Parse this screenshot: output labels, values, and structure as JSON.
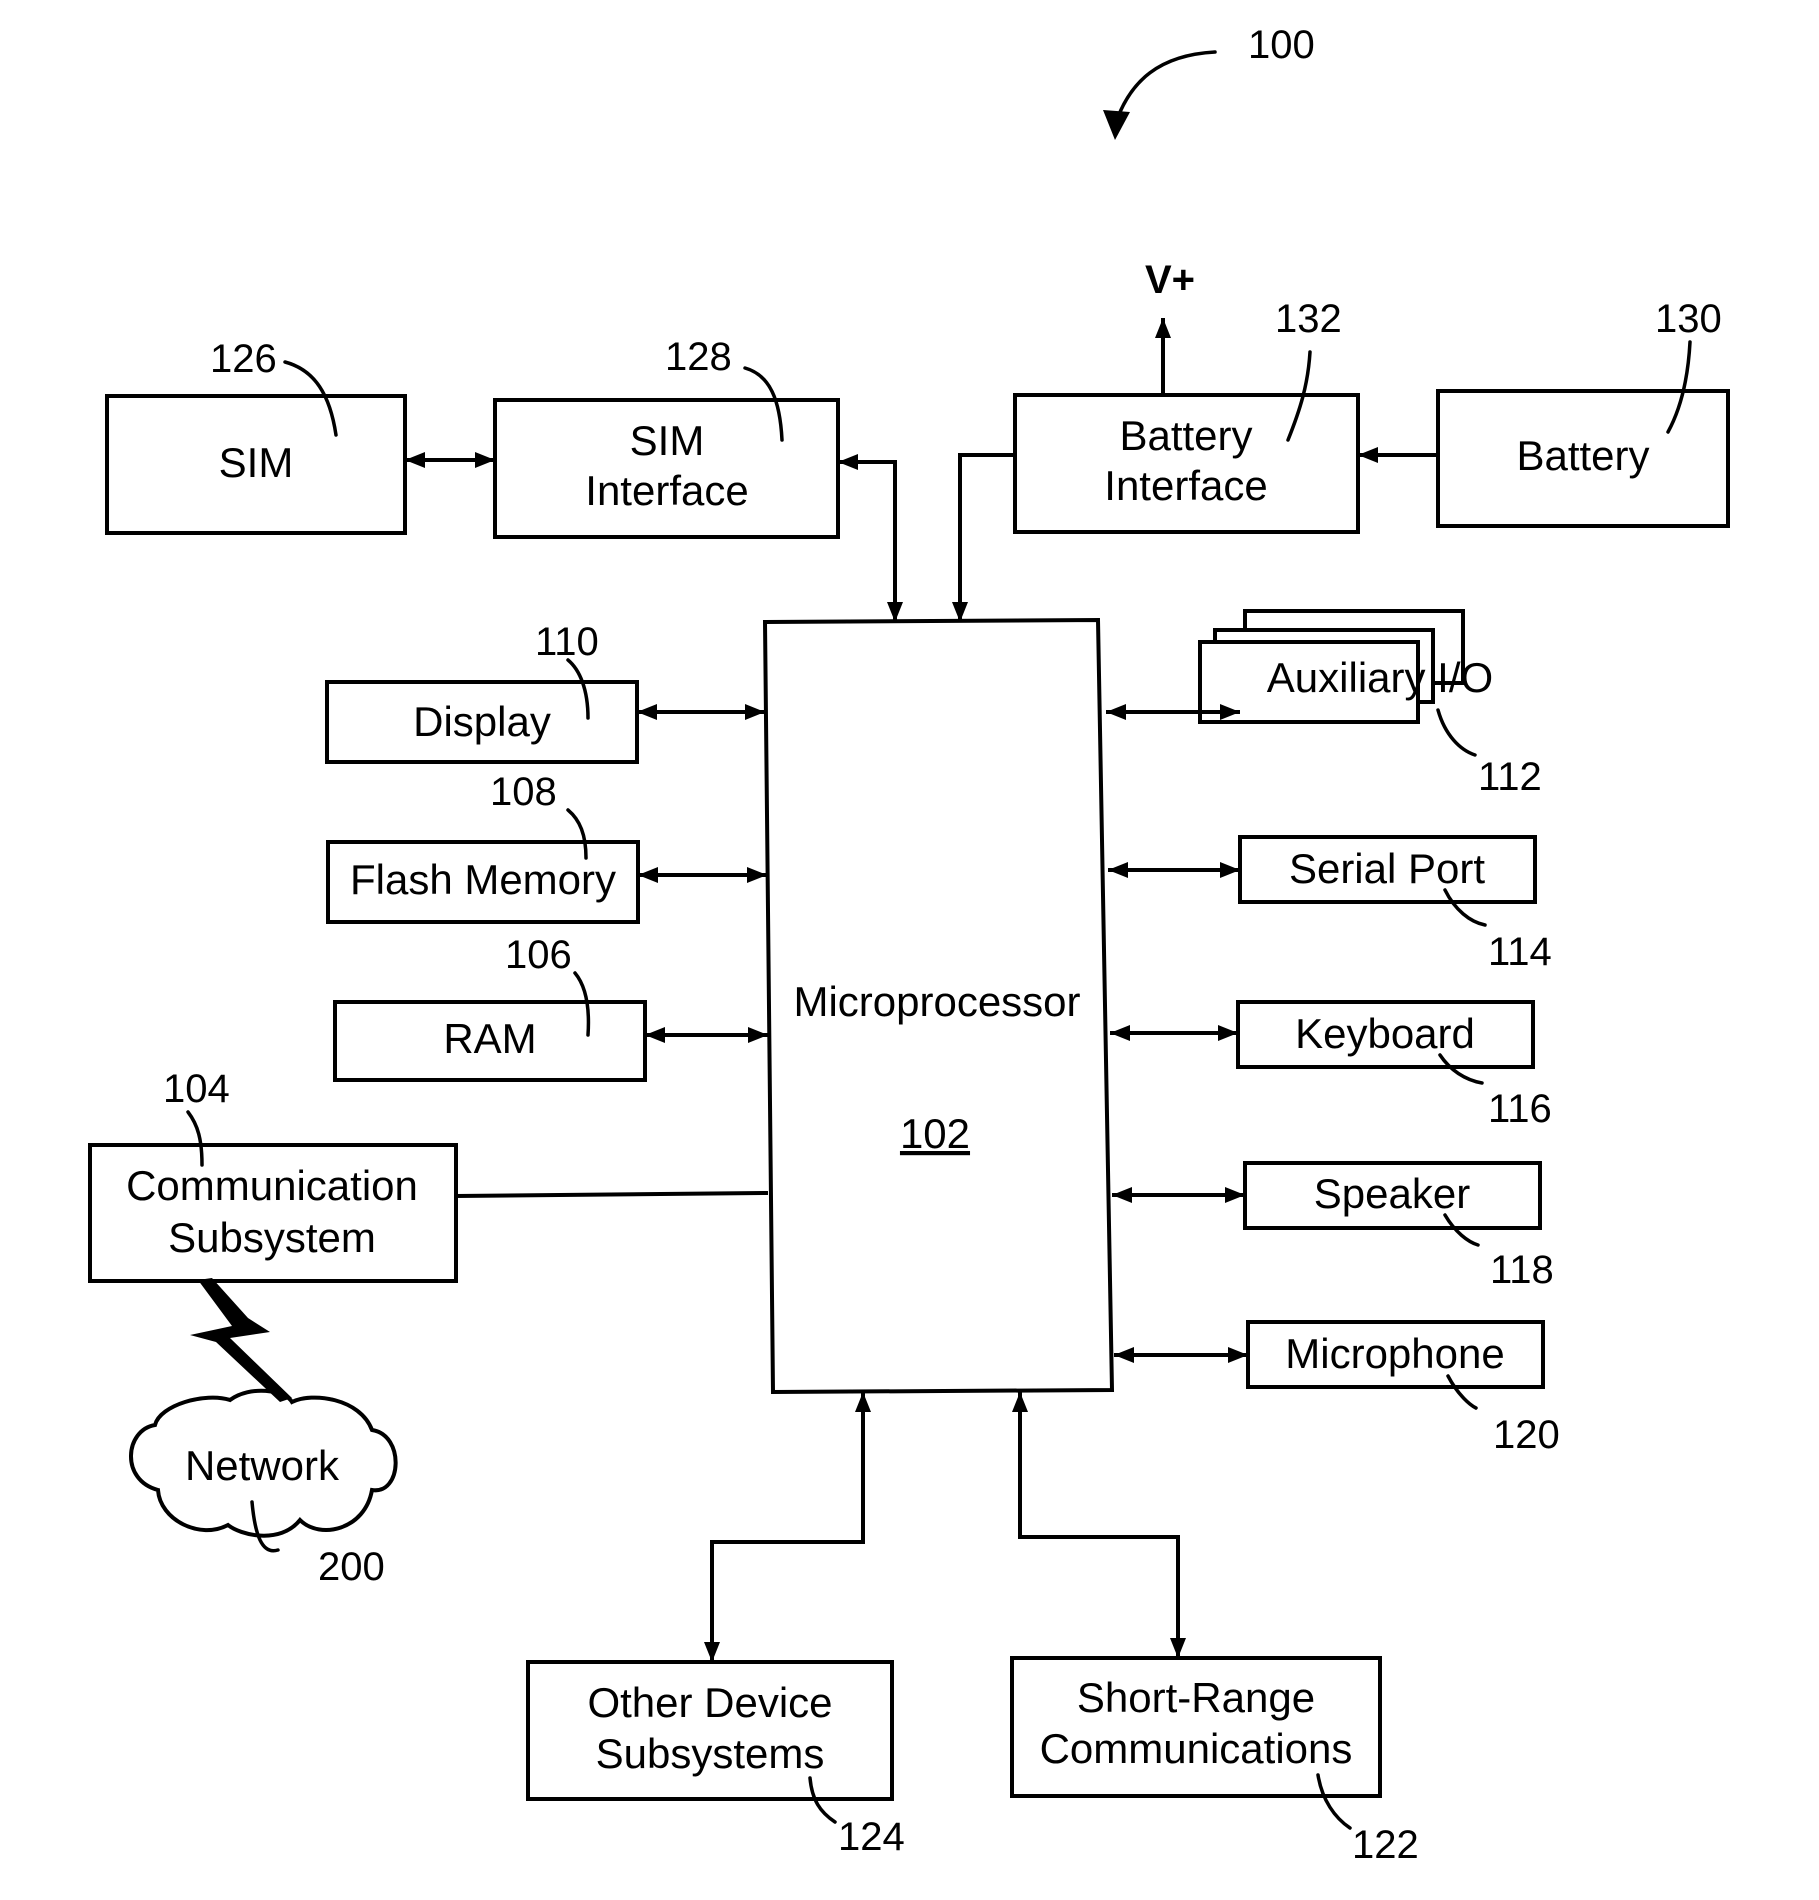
{
  "figure": {
    "figure_ref": "100",
    "vplus": "V+"
  },
  "blocks": {
    "sim": {
      "label_lines": [
        "SIM"
      ],
      "ref": "126"
    },
    "sim_interface": {
      "label_lines": [
        "SIM",
        "Interface"
      ],
      "ref": "128"
    },
    "battery_interface": {
      "label_lines": [
        "Battery",
        "Interface"
      ],
      "ref": "132"
    },
    "battery": {
      "label_lines": [
        "Battery"
      ],
      "ref": "130"
    },
    "display": {
      "label_lines": [
        "Display"
      ],
      "ref": "110"
    },
    "flash_memory": {
      "label_lines": [
        "Flash Memory"
      ],
      "ref": "108"
    },
    "ram": {
      "label_lines": [
        "RAM"
      ],
      "ref": "106"
    },
    "communication_subsystem": {
      "label_lines": [
        "Communication",
        "Subsystem"
      ],
      "ref": "104"
    },
    "network": {
      "label_lines": [
        "Network"
      ],
      "ref": "200"
    },
    "microprocessor": {
      "label_lines": [
        "Microprocessor"
      ],
      "ref": "102"
    },
    "auxiliary_io": {
      "label_lines": [
        "Auxiliary I/O"
      ],
      "ref": "112"
    },
    "serial_port": {
      "label_lines": [
        "Serial Port"
      ],
      "ref": "114"
    },
    "keyboard": {
      "label_lines": [
        "Keyboard"
      ],
      "ref": "116"
    },
    "speaker": {
      "label_lines": [
        "Speaker"
      ],
      "ref": "118"
    },
    "microphone": {
      "label_lines": [
        "Microphone"
      ],
      "ref": "120"
    },
    "other_device_subsystems": {
      "label_lines": [
        "Other Device",
        "Subsystems"
      ],
      "ref": "124"
    },
    "short_range_communications": {
      "label_lines": [
        "Short-Range",
        "Communications"
      ],
      "ref": "122"
    }
  }
}
